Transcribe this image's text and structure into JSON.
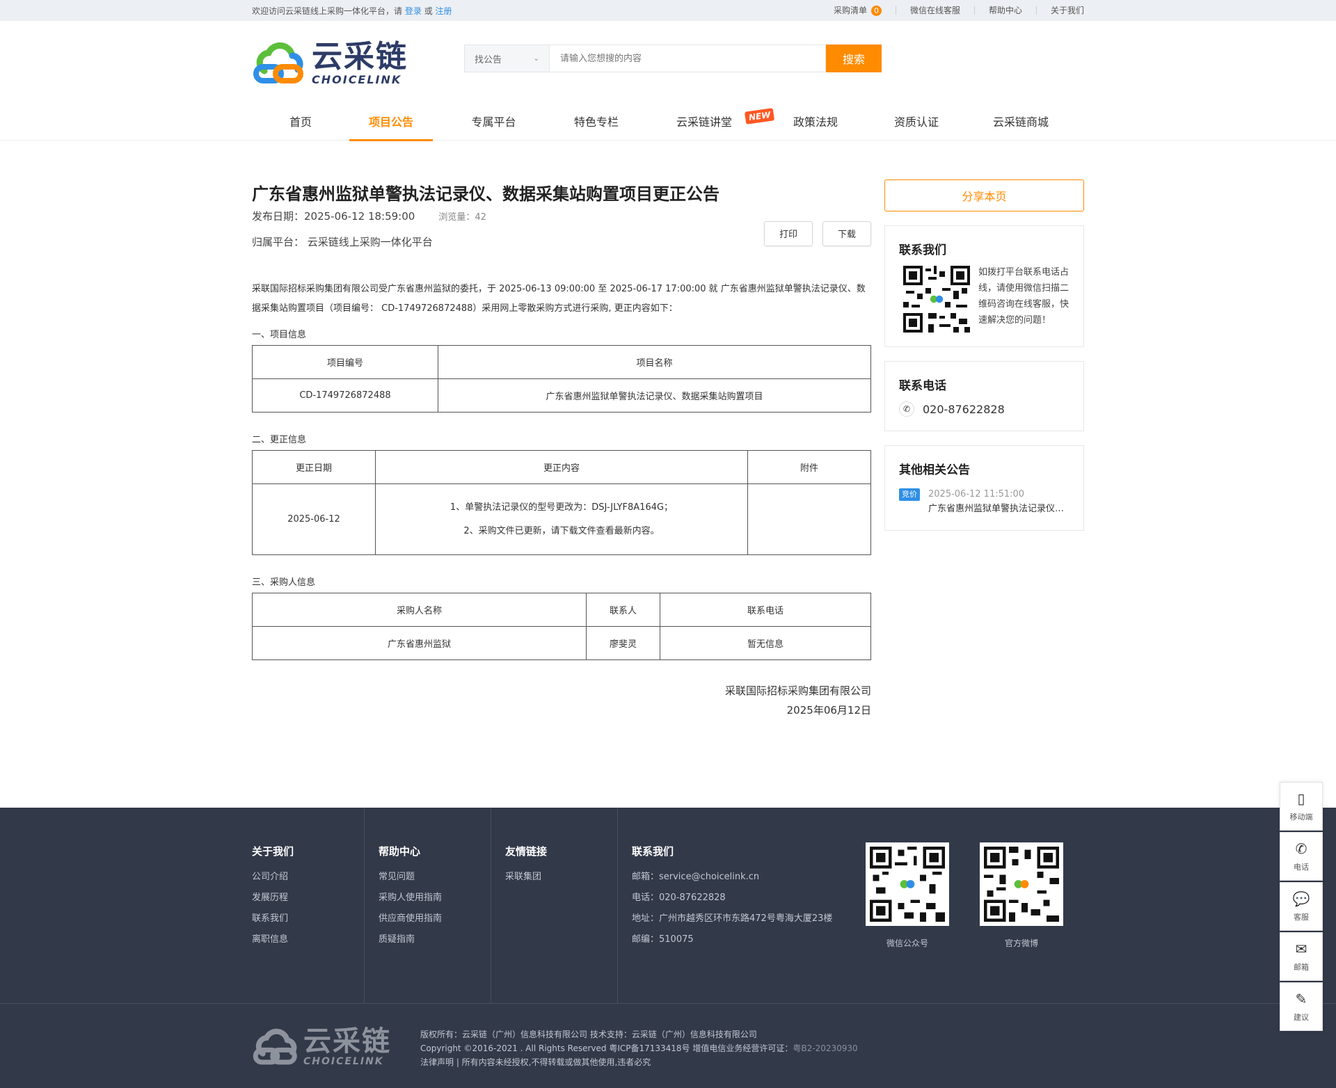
{
  "topbar": {
    "welcome_prefix": "欢迎访问云采链线上采购一体化平台，请",
    "login": "登录",
    "or": "或",
    "register": "注册",
    "cart_label": "采购清单",
    "cart_count": "0",
    "wechat_service": "微信在线客服",
    "help_center": "帮助中心",
    "about_us": "关于我们"
  },
  "logo": {
    "cn": "云采链",
    "en": "CHOICELINK"
  },
  "search": {
    "select_value": "找公告",
    "placeholder": "请输入您想搜的内容",
    "button": "搜索"
  },
  "nav": {
    "items": [
      "首页",
      "项目公告",
      "专属平台",
      "特色专栏",
      "云采链讲堂",
      "政策法规",
      "资质认证",
      "云采链商城"
    ],
    "active_index": 1,
    "new_tag": "NEW"
  },
  "article": {
    "title": "广东省惠州监狱单警执法记录仪、数据采集站购置项目更正公告",
    "publish_date": "发布日期：2025-06-12 18:59:00",
    "views": "浏览量：42",
    "platform": "归属平台：  云采链线上采购一体化平台",
    "print": "打印",
    "download": "下载",
    "intro": "采联国际招标采购集团有限公司受广东省惠州监狱的委托，于 2025-06-13 09:00:00 至 2025-06-17 17:00:00 就 广东省惠州监狱单警执法记录仪、数据采集站购置项目（项目编号： CD-1749726872488）采用网上零散采购方式进行采购, 更正内容如下：",
    "sec1_title": "一、项目信息",
    "sec1_headers": [
      "项目编号",
      "项目名称"
    ],
    "sec1_row": [
      "CD-1749726872488",
      "广东省惠州监狱单警执法记录仪、数据采集站购置项目"
    ],
    "sec2_title": "二、更正信息",
    "sec2_headers": [
      "更正日期",
      "更正内容",
      "附件"
    ],
    "sec2_date": "2025-06-12",
    "sec2_line1": "1、单警执法记录仪的型号更改为：DSJ-JLYF8A164G；",
    "sec2_line2": "2、采购文件已更新，请下载文件查看最新内容。",
    "sec2_attach": "",
    "sec3_title": "三、采购人信息",
    "sec3_headers": [
      "采购人名称",
      "联系人",
      "联系电话"
    ],
    "sec3_row": [
      "广东省惠州监狱",
      "廖斐灵",
      "暂无信息"
    ],
    "sign_company": "采联国际招标采购集团有限公司",
    "sign_date": "2025年06月12日"
  },
  "sidebar": {
    "share": "分享本页",
    "contact_title": "联系我们",
    "contact_text": "如拨打平台联系电话占线，请使用微信扫描二维码咨询在线客服，快速解决您的问题！",
    "phone_title": "联系电话",
    "phone": "020-87622828",
    "related_title": "其他相关公告",
    "related_tag": "竞价",
    "related_date": "2025-06-12 11:51:00",
    "related_name": "广东省惠州监狱单警执法记录仪、数据采集站购置项目"
  },
  "footer": {
    "col1_title": "关于我们",
    "col1_items": [
      "公司介绍",
      "发展历程",
      "联系我们",
      "离职信息"
    ],
    "col2_title": "帮助中心",
    "col2_items": [
      "常见问题",
      "采购人使用指南",
      "供应商使用指南",
      "质疑指南"
    ],
    "col3_title": "友情链接",
    "col3_items": [
      "采联集团"
    ],
    "col4_title": "联系我们",
    "col4_items": [
      "邮箱：service@choicelink.cn",
      "电话：020-87622828",
      "地址：广州市越秀区环市东路472号粤海大厦23楼",
      "邮编：510075"
    ],
    "qr1_caption": "微信公众号",
    "qr2_caption": "官方微博",
    "copy_line1": "版权所有：云采链（广州）信息科技有限公司   技术支持：云采链（广州）信息科技有限公司",
    "copy_line2": "Copyright ©2016-2021 . All Rights Reserved 粤ICP备17133418号    增值电信业务经营许可证：",
    "copy_license": "粤B2-20230930",
    "copy_line3": "法律声明 | 所有内容未经授权,不得转载或做其他使用,违者必究"
  },
  "float_bar": [
    "移动端",
    "电话",
    "客服",
    "邮箱",
    "建议"
  ],
  "colors": {
    "accent": "#ff8b00",
    "link": "#2f8fe6",
    "footer_bg": "#323949"
  }
}
